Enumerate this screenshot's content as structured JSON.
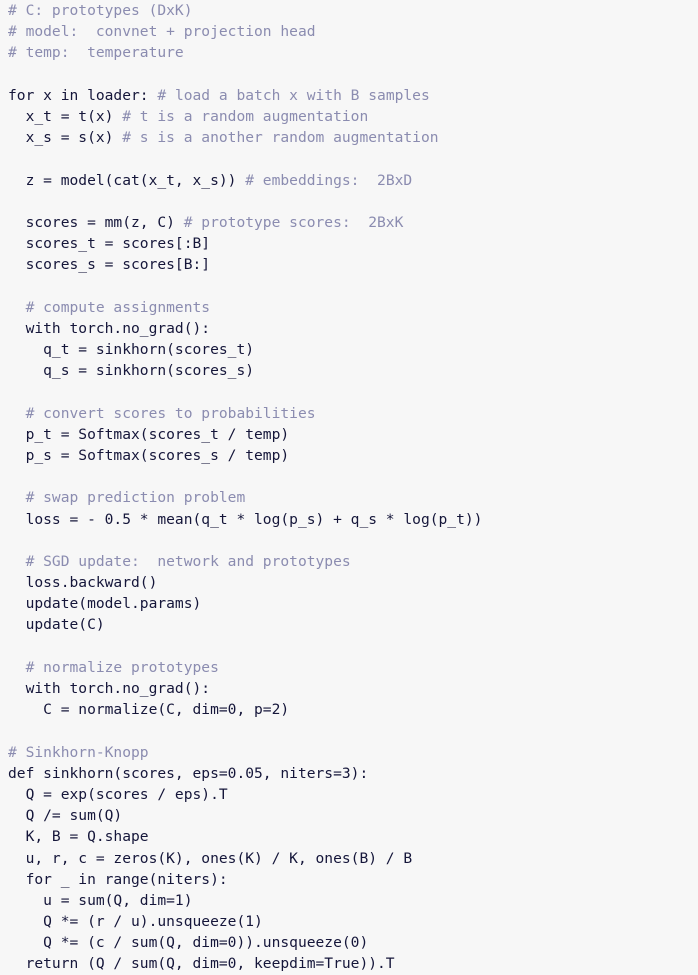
{
  "document": {
    "kind": "code-listing",
    "language": "python-pseudocode",
    "background_color": "#f7f7f7",
    "code_color": "#15163a",
    "comment_color": "#8b8cb0"
  },
  "lines": [
    {
      "indent": 0,
      "code": "",
      "comment": "# C: prototypes (DxK)"
    },
    {
      "indent": 0,
      "code": "",
      "comment": "# model:  convnet + projection head"
    },
    {
      "indent": 0,
      "code": "",
      "comment": "# temp:  temperature"
    },
    {
      "indent": 0,
      "code": "",
      "comment": ""
    },
    {
      "indent": 0,
      "code": "for x in loader:",
      "comment": " # load a batch x with B samples"
    },
    {
      "indent": 1,
      "code": "x_t = t(x)",
      "comment": " # t is a random augmentation"
    },
    {
      "indent": 1,
      "code": "x_s = s(x)",
      "comment": " # s is a another random augmentation"
    },
    {
      "indent": 1,
      "code": "",
      "comment": ""
    },
    {
      "indent": 1,
      "code": "z = model(cat(x_t, x_s))",
      "comment": " # embeddings:  2BxD"
    },
    {
      "indent": 1,
      "code": "",
      "comment": ""
    },
    {
      "indent": 1,
      "code": "scores = mm(z, C)",
      "comment": " # prototype scores:  2BxK"
    },
    {
      "indent": 1,
      "code": "scores_t = scores[:B]",
      "comment": ""
    },
    {
      "indent": 1,
      "code": "scores_s = scores[B:]",
      "comment": ""
    },
    {
      "indent": 1,
      "code": "",
      "comment": ""
    },
    {
      "indent": 1,
      "code": "",
      "comment": "# compute assignments"
    },
    {
      "indent": 1,
      "code": "with torch.no_grad():",
      "comment": ""
    },
    {
      "indent": 2,
      "code": "q_t = sinkhorn(scores_t)",
      "comment": ""
    },
    {
      "indent": 2,
      "code": "q_s = sinkhorn(scores_s)",
      "comment": ""
    },
    {
      "indent": 1,
      "code": "",
      "comment": ""
    },
    {
      "indent": 1,
      "code": "",
      "comment": "# convert scores to probabilities"
    },
    {
      "indent": 1,
      "code": "p_t = Softmax(scores_t / temp)",
      "comment": ""
    },
    {
      "indent": 1,
      "code": "p_s = Softmax(scores_s / temp)",
      "comment": ""
    },
    {
      "indent": 1,
      "code": "",
      "comment": ""
    },
    {
      "indent": 1,
      "code": "",
      "comment": "# swap prediction problem"
    },
    {
      "indent": 1,
      "code": "loss = - 0.5 * mean(q_t * log(p_s) + q_s * log(p_t))",
      "comment": ""
    },
    {
      "indent": 1,
      "code": "",
      "comment": ""
    },
    {
      "indent": 1,
      "code": "",
      "comment": "# SGD update:  network and prototypes"
    },
    {
      "indent": 1,
      "code": "loss.backward()",
      "comment": ""
    },
    {
      "indent": 1,
      "code": "update(model.params)",
      "comment": ""
    },
    {
      "indent": 1,
      "code": "update(C)",
      "comment": ""
    },
    {
      "indent": 1,
      "code": "",
      "comment": ""
    },
    {
      "indent": 1,
      "code": "",
      "comment": "# normalize prototypes"
    },
    {
      "indent": 1,
      "code": "with torch.no_grad():",
      "comment": ""
    },
    {
      "indent": 2,
      "code": "C = normalize(C, dim=0, p=2)",
      "comment": ""
    },
    {
      "indent": 0,
      "code": "",
      "comment": ""
    },
    {
      "indent": 0,
      "code": "",
      "comment": "# Sinkhorn-Knopp"
    },
    {
      "indent": 0,
      "code": "def sinkhorn(scores, eps=0.05, niters=3):",
      "comment": ""
    },
    {
      "indent": 1,
      "code": "Q = exp(scores / eps).T",
      "comment": ""
    },
    {
      "indent": 1,
      "code": "Q /= sum(Q)",
      "comment": ""
    },
    {
      "indent": 1,
      "code": "K, B = Q.shape",
      "comment": ""
    },
    {
      "indent": 1,
      "code": "u, r, c = zeros(K), ones(K) / K, ones(B) / B",
      "comment": ""
    },
    {
      "indent": 1,
      "code": "for _ in range(niters):",
      "comment": ""
    },
    {
      "indent": 2,
      "code": "u = sum(Q, dim=1)",
      "comment": ""
    },
    {
      "indent": 2,
      "code": "Q *= (r / u).unsqueeze(1)",
      "comment": ""
    },
    {
      "indent": 2,
      "code": "Q *= (c / sum(Q, dim=0)).unsqueeze(0)",
      "comment": ""
    },
    {
      "indent": 1,
      "code": "return (Q / sum(Q, dim=0, keepdim=True)).T",
      "comment": ""
    }
  ]
}
